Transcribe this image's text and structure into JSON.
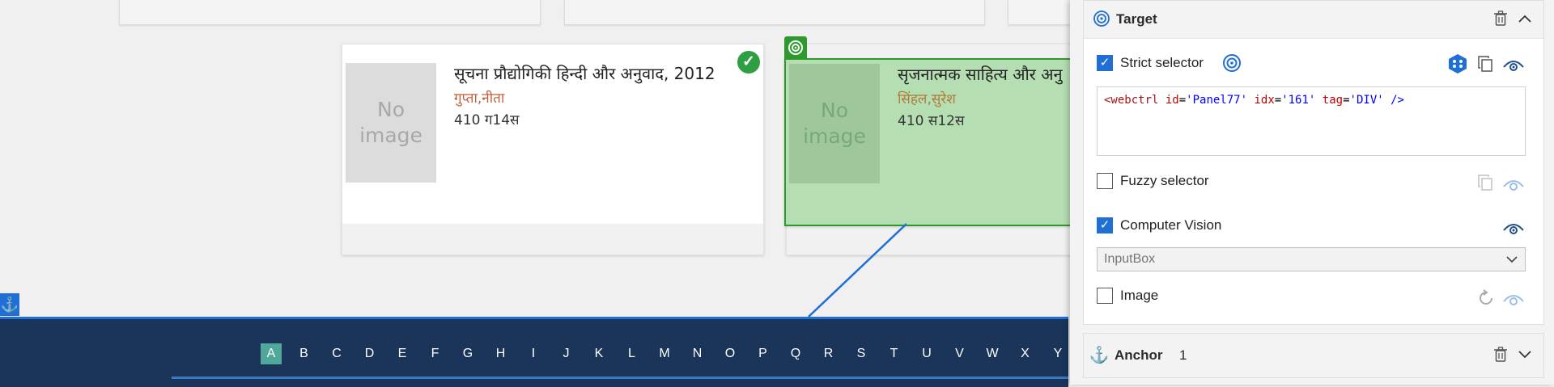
{
  "books": [
    {
      "title": "सूचना प्रौद्योगिकी हिन्दी और अनुवाद, 2012",
      "author": "गुप्ता,नीता",
      "call_number": "410 ग14स",
      "image_placeholder": "No image",
      "badge": "check-icon"
    },
    {
      "title": "सृजनात्मक साहित्य और अनु",
      "author": "सिंहल,सुरेश",
      "call_number": "410 स12स",
      "image_placeholder": "No image",
      "badge": "target-icon"
    }
  ],
  "alphabet": {
    "letters": [
      "A",
      "B",
      "C",
      "D",
      "E",
      "F",
      "G",
      "H",
      "I",
      "J",
      "K",
      "L",
      "M",
      "N",
      "O",
      "P",
      "Q",
      "R",
      "S",
      "T",
      "U",
      "V",
      "W",
      "X",
      "Y"
    ],
    "active": "A"
  },
  "panel": {
    "target": {
      "title": "Target",
      "strict_selector": {
        "label": "Strict selector",
        "checked": true,
        "code": {
          "open": "<webctrl",
          "attrs": [
            {
              "name": "id",
              "value": "'Panel77'"
            },
            {
              "name": "idx",
              "value": "'161'"
            },
            {
              "name": "tag",
              "value": "'DIV'"
            }
          ],
          "close": "/>"
        }
      },
      "fuzzy_selector": {
        "label": "Fuzzy selector",
        "checked": false
      },
      "computer_vision": {
        "label": "Computer Vision",
        "checked": true,
        "dropdown_value": "InputBox"
      },
      "image": {
        "label": "Image",
        "checked": false
      }
    },
    "anchor": {
      "title": "Anchor",
      "count": "1"
    }
  },
  "colors": {
    "accent": "#1f6fd6",
    "highlight_green": "#2e9a2e",
    "alpha_bar": "#1a3559",
    "author_text": "#c0603c"
  }
}
